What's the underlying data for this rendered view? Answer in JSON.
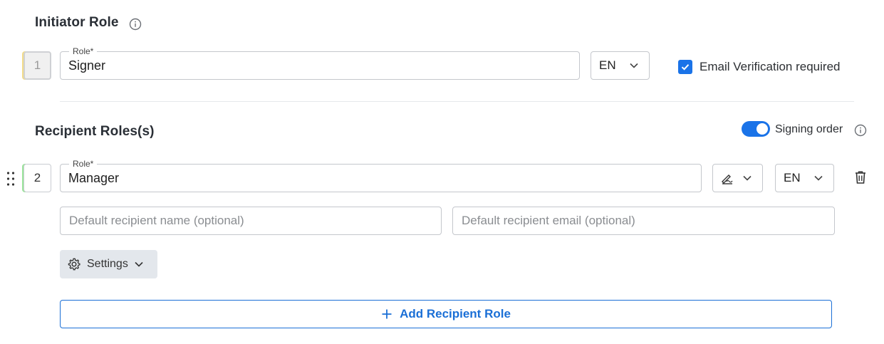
{
  "initiator": {
    "title": "Initiator Role",
    "number": "1",
    "role_label": "Role*",
    "role_value": "Signer",
    "language": "EN",
    "email_verification_label": "Email Verification required",
    "email_verification_checked": true
  },
  "recipients": {
    "title": "Recipient Roles(s)",
    "signing_order_label": "Signing order",
    "signing_order_enabled": true,
    "items": [
      {
        "number": "2",
        "role_label": "Role*",
        "role_value": "Manager",
        "language": "EN",
        "action_icon": "signature-icon",
        "name_placeholder": "Default recipient name (optional)",
        "email_placeholder": "Default recipient email (optional)",
        "settings_label": "Settings"
      }
    ],
    "add_button_label": "Add Recipient Role"
  },
  "colors": {
    "accent": "#1a73e8",
    "initiator_stripe": "#f3dc8a",
    "recipient_stripe": "#9be59b"
  }
}
